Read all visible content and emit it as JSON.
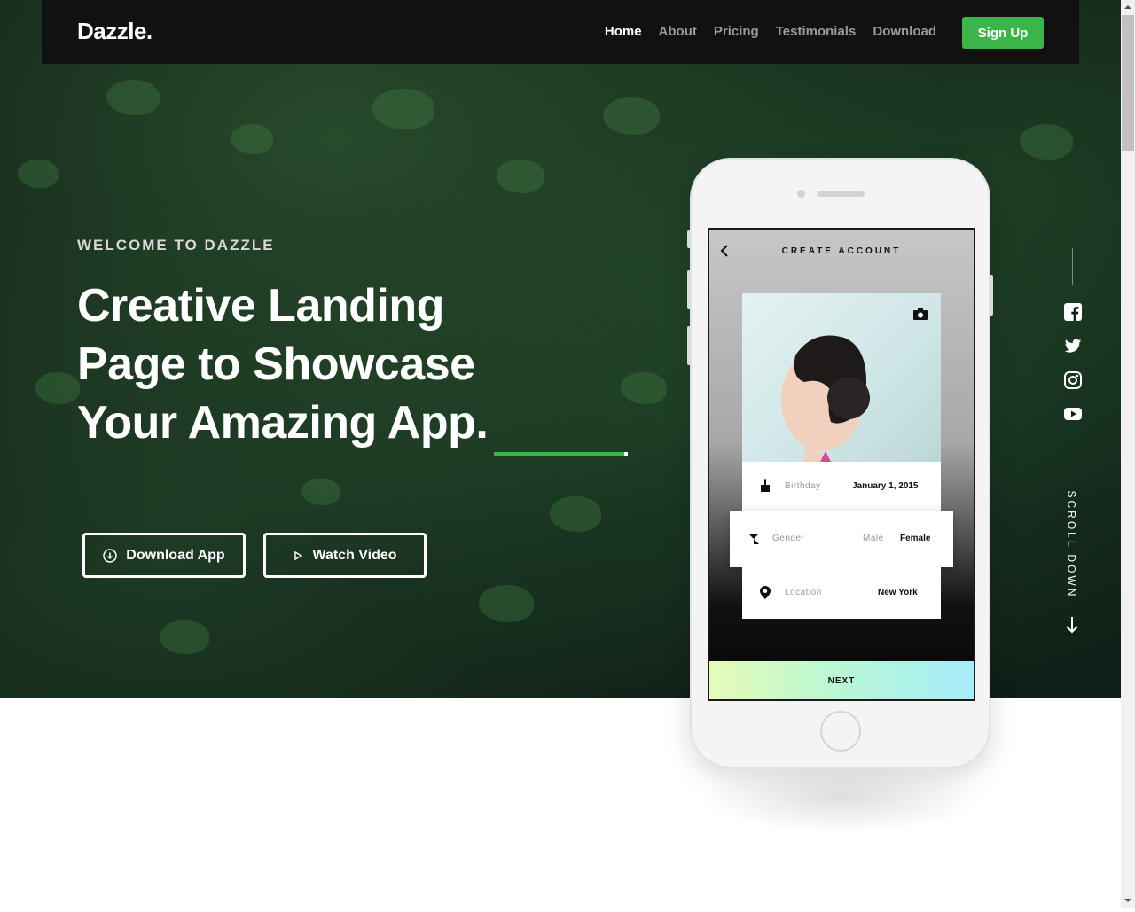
{
  "brand": {
    "logo": "Dazzle.",
    "accent": "#3bb54a"
  },
  "nav": {
    "items": [
      {
        "label": "Home",
        "active": true
      },
      {
        "label": "About"
      },
      {
        "label": "Pricing"
      },
      {
        "label": "Testimonials"
      },
      {
        "label": "Download"
      }
    ],
    "signup_label": "Sign Up"
  },
  "hero": {
    "eyebrow": "WELCOME TO DAZZLE",
    "headline_line1": "Creative Landing",
    "headline_line2": "Page to Showcase",
    "headline_line3": "Your Amazing App.",
    "download_label": "Download App",
    "video_label": "Watch Video"
  },
  "social": {
    "icons": [
      "facebook-icon",
      "twitter-icon",
      "instagram-icon",
      "youtube-icon"
    ],
    "scroll_label": "SCROLL DOWN"
  },
  "phone_screen": {
    "title": "CREATE ACCOUNT",
    "birthday_label": "Birthday",
    "birthday_value": "January 1, 2015",
    "gender_label": "Gender",
    "gender_option_male": "Male",
    "gender_option_female": "Female",
    "location_label": "Location",
    "location_value": "New York",
    "next_label": "NEXT"
  }
}
